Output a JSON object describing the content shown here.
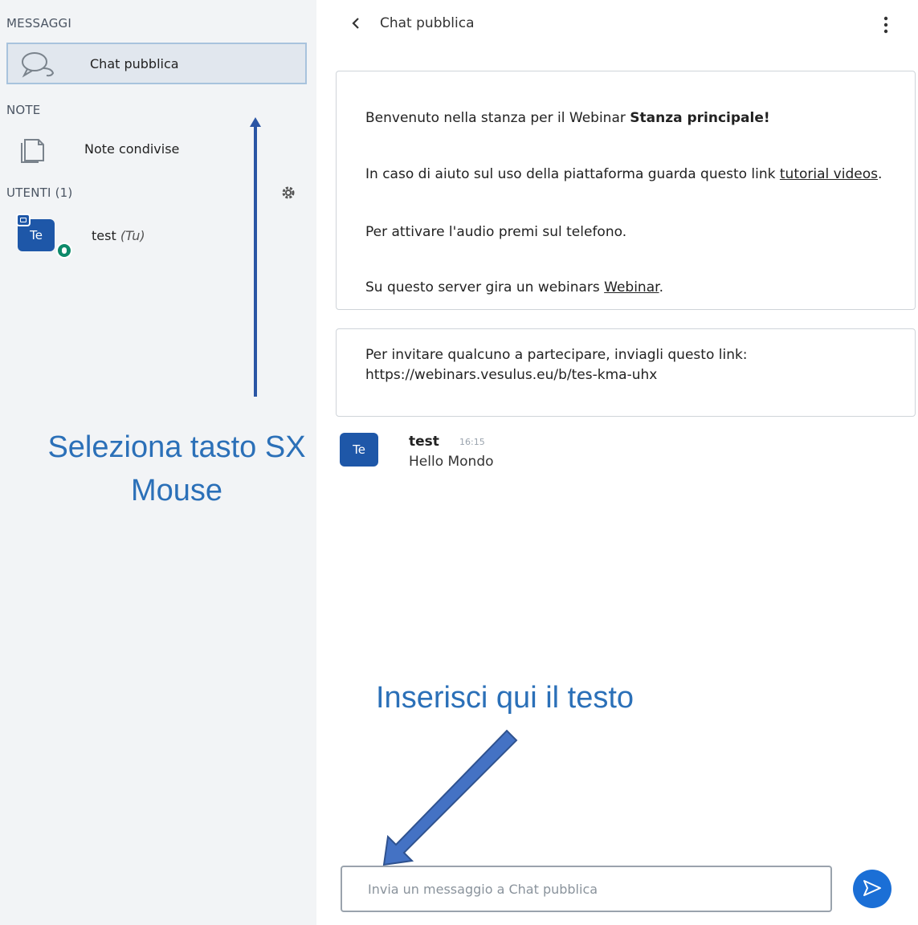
{
  "sidebar": {
    "messages_title": "MESSAGGI",
    "chat_item_label": "Chat pubblica",
    "notes_title": "NOTE",
    "notes_item_label": "Note condivise",
    "users_title": "UTENTI (1)",
    "user": {
      "initials": "Te",
      "name": "test",
      "you_tag": "(Tu)"
    }
  },
  "chat": {
    "header_title": "Chat pubblica",
    "welcome": {
      "line1_prefix": "Benvenuto nella stanza per il Webinar ",
      "line1_bold": "Stanza principale!",
      "line2_prefix": "In caso di aiuto sul uso della piattaforma guarda questo link ",
      "line2_link": "tutorial videos",
      "line2_suffix": ".",
      "line3": "Per attivare l'audio premi sul telefono.",
      "line4_prefix": "Su questo server gira un webinars ",
      "line4_link": "Webinar",
      "line4_suffix": "."
    },
    "invite_text": "Per invitare qualcuno a partecipare, inviagli questo link: https://webinars.vesulus.eu/b/tes-kma-uhx",
    "message": {
      "avatar_initials": "Te",
      "author": "test",
      "time": "16:15",
      "text": "Hello Mondo"
    },
    "input_placeholder": "Invia un messaggio a Chat pubblica"
  },
  "annotations": {
    "left_hint": "Seleziona tasto SX Mouse",
    "input_hint": "Inserisci qui il testo",
    "arrow_color": "#4472c4"
  },
  "colors": {
    "accent": "#1b6fd6",
    "avatar": "#1e57a8",
    "audio_badge": "#0d8a6a",
    "annotation_text": "#2b70b8"
  }
}
